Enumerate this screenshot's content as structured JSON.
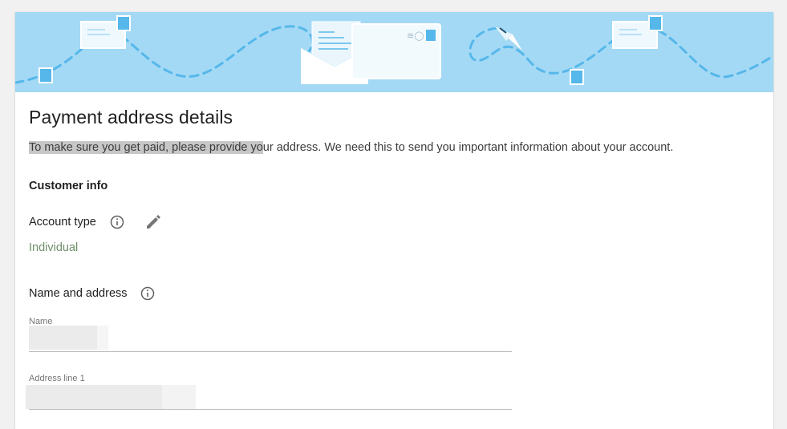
{
  "page": {
    "title": "Payment address details",
    "intro_highlighted": "To make sure you get paid, please provide yo",
    "intro_rest": "ur address. We need this to send you important information about your account."
  },
  "customer_info": {
    "heading": "Customer info",
    "account_type_label": "Account type",
    "account_type_value": "Individual"
  },
  "name_address": {
    "heading": "Name and address",
    "name_label": "Name",
    "name_value": "",
    "address1_label": "Address line 1",
    "address1_value": ""
  },
  "icons": {
    "info": "info-circle-icon",
    "edit": "pencil-icon"
  },
  "colors": {
    "banner": "#a3d9f5",
    "accent_blue": "#4fb3ee",
    "value_green": "#6f8f6a"
  }
}
